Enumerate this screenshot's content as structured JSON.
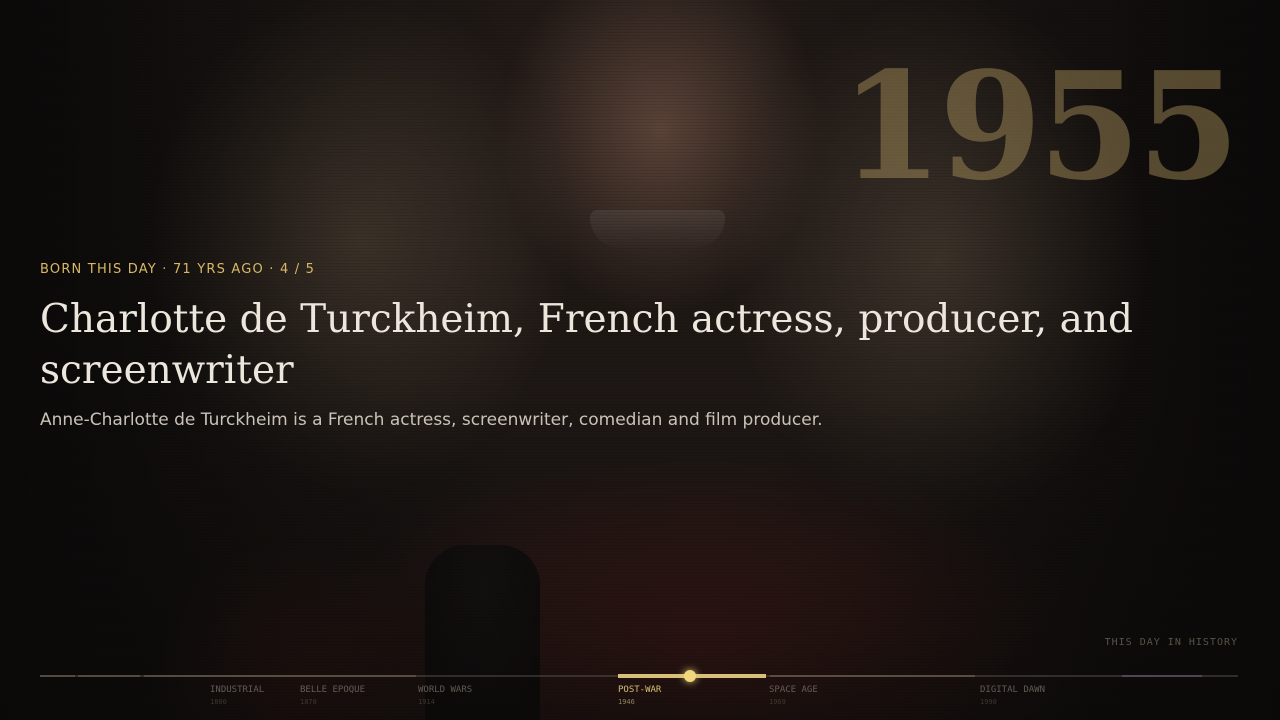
{
  "hero": {
    "year": "1955",
    "kicker": "BORN THIS DAY · 71 YRS AGO · 4 / 5",
    "title": "Charlotte de Turckheim, French actress, producer, and screenwriter",
    "summary": "Anne-Charlotte de Turckheim is a French actress, screenwriter, comedian and film producer."
  },
  "section_label": "THIS DAY IN HISTORY",
  "timeline": {
    "eras": [
      {
        "name": "INDUSTRIAL",
        "year": "1800"
      },
      {
        "name": "BELLE EPOQUE",
        "year": "1870"
      },
      {
        "name": "WORLD WARS",
        "year": "1914"
      },
      {
        "name": "POST-WAR",
        "year": "1946"
      },
      {
        "name": "SPACE AGE",
        "year": "1969"
      },
      {
        "name": "DIGITAL DAWN",
        "year": "1990"
      }
    ],
    "active_era": "POST-WAR",
    "accent_color": "#d9bf73"
  }
}
